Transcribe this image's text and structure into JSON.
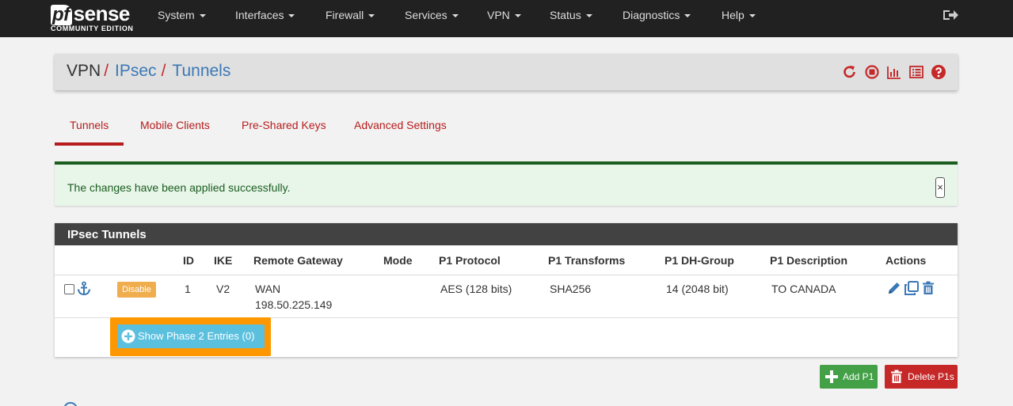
{
  "brand": {
    "logo_pf": "pf",
    "logo_main": "sense",
    "edition": "COMMUNITY EDITION"
  },
  "nav": {
    "items": [
      "System",
      "Interfaces",
      "Firewall",
      "Services",
      "VPN",
      "Status",
      "Diagnostics",
      "Help"
    ],
    "logout_icon": "sign-out-icon"
  },
  "breadcrumb": {
    "root": "VPN",
    "sep": "/",
    "section": "IPsec",
    "page": "Tunnels"
  },
  "header_icons": [
    "reload-icon",
    "stop-icon",
    "chart-icon",
    "log-list-icon",
    "help-icon"
  ],
  "tabs": [
    "Tunnels",
    "Mobile Clients",
    "Pre-Shared Keys",
    "Advanced Settings"
  ],
  "active_tab": "Tunnels",
  "alert": {
    "message": "The changes have been applied successfully.",
    "close": "×"
  },
  "panel": {
    "title": "IPsec Tunnels",
    "columns": [
      "ID",
      "IKE",
      "Remote Gateway",
      "Mode",
      "P1 Protocol",
      "P1 Transforms",
      "P1 DH-Group",
      "P1 Description",
      "Actions"
    ],
    "rows": [
      {
        "disable_label": "Disable",
        "id": "1",
        "ike": "V2",
        "remote_gateway_if": "WAN",
        "remote_gateway_ip": "198.50.225.149",
        "mode": "",
        "p1_protocol": "AES (128 bits)",
        "p1_transforms": "SHA256",
        "p1_dh_group": "14 (2048 bit)",
        "p1_description": "TO CANADA"
      }
    ],
    "show_phase2_label": "Show Phase 2 Entries (0)"
  },
  "buttons": {
    "add_p1": "Add P1",
    "delete_p1s": "Delete P1s"
  },
  "colors": {
    "navbar": "#212121",
    "accent_red": "#b71c1c",
    "link_blue": "#3b78b5",
    "success": "#1b5e20",
    "info": "#5bc0de",
    "highlight": "#ff9800",
    "add": "#43a047",
    "delete": "#c62828",
    "warning": "#f0ad4e"
  }
}
